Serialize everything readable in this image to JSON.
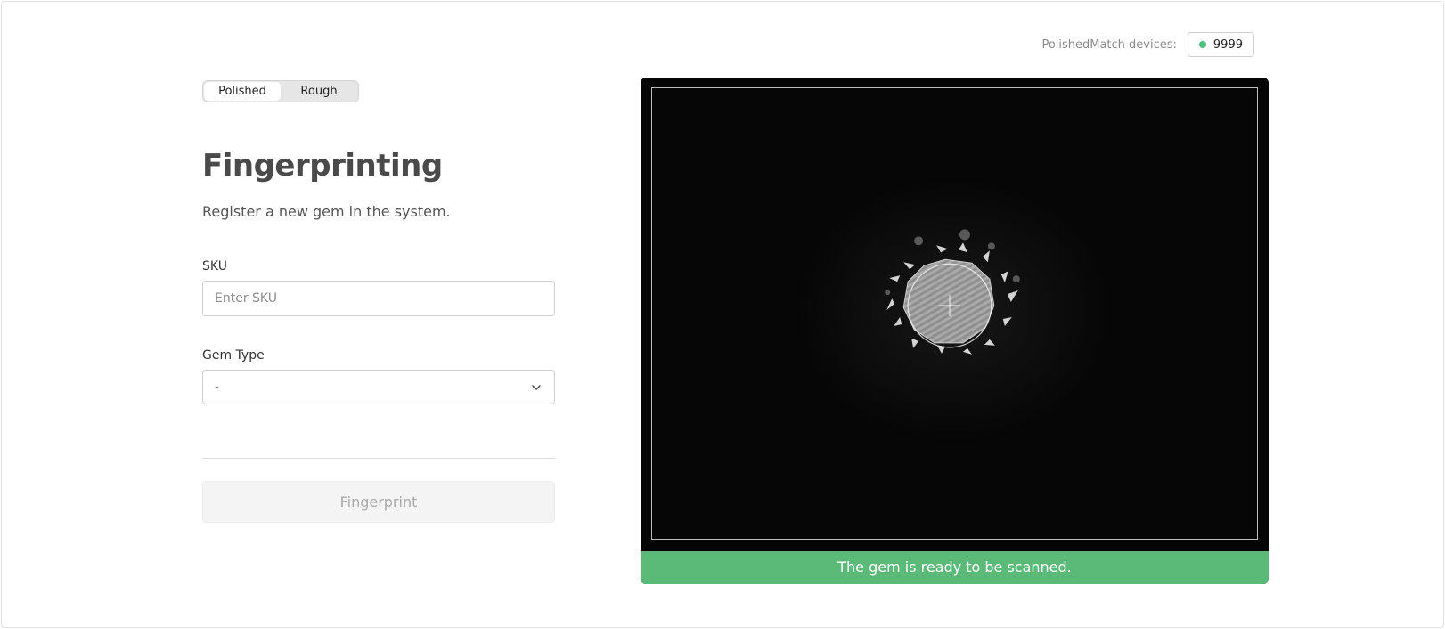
{
  "devices": {
    "label": "PolishedMatch devices:",
    "count": "9999",
    "status_color": "#4fbf7a"
  },
  "mode_toggle": {
    "options": [
      "Polished",
      "Rough"
    ],
    "selected": "Polished"
  },
  "page": {
    "title": "Fingerprinting",
    "subtitle": "Register a new gem in the system."
  },
  "form": {
    "sku": {
      "label": "SKU",
      "value": "",
      "placeholder": "Enter SKU"
    },
    "gem_type": {
      "label": "Gem Type",
      "value": "-",
      "icon": "chevron-down-icon"
    },
    "submit_label": "Fingerprint"
  },
  "viewer": {
    "status_text": "The gem is ready to be scanned.",
    "status_color": "#5cba78"
  }
}
